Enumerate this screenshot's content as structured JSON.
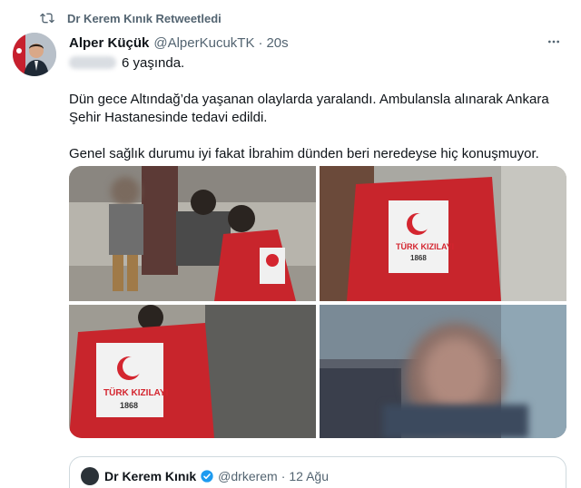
{
  "retweet": {
    "label": "Dr Kerem Kınık Retweetledi",
    "icon": "retweet-icon"
  },
  "tweet": {
    "author_name": "Alper Küçük",
    "author_handle": "@AlperKucukTK",
    "separator": "·",
    "time": "20s",
    "line1": "6 yaşında.",
    "paragraph1_line1": "Dün gece Altındağ’da yaşanan olaylarda yaralandı. Ambulansla alınarak Ankara",
    "paragraph1_line2": "Şehir Hastanesinde tedavi edildi.",
    "paragraph2": "Genel sağlık durumu iyi fakat  İbrahim dünden beri neredeyse hiç konuşmuyor."
  },
  "media": {
    "vest_logo_line1": "TÜRK KIZILAYI",
    "vest_year": "1868",
    "accent": "#d4252f"
  },
  "quote": {
    "author_name": "Dr Kerem Kınık",
    "author_handle": "@drkerem",
    "separator": "·",
    "time": "12 Ağu"
  },
  "colors": {
    "text": "#0f1419",
    "secondary": "#536471",
    "verified": "#1d9bf0",
    "border": "#cfd9de"
  }
}
